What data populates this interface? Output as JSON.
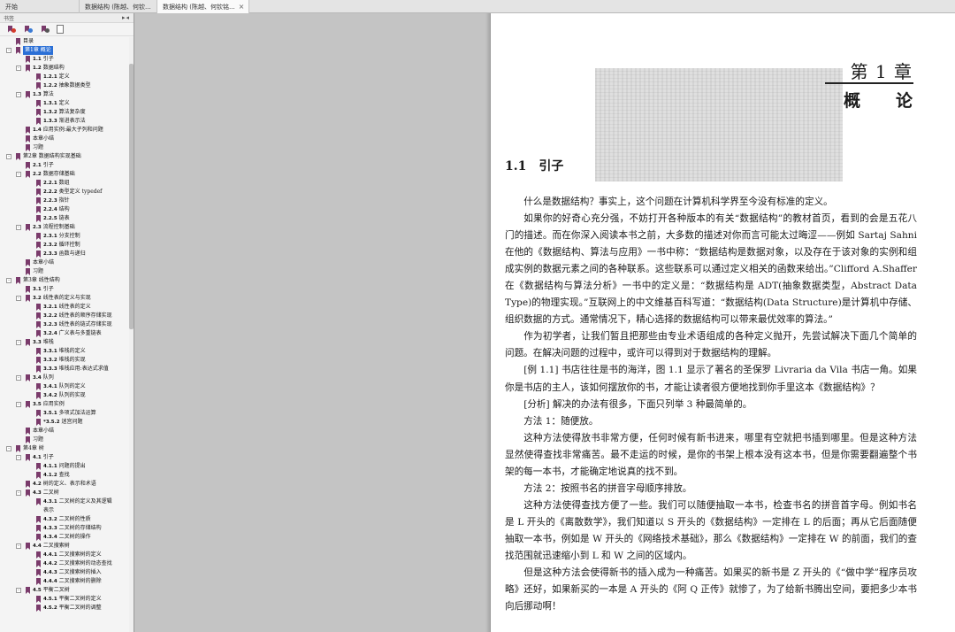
{
  "tabs": [
    {
      "label": "开始"
    },
    {
      "label": "数据结构 (陈越、何钦..."
    },
    {
      "label": "数据结构 (陈越、何钦铭..."
    }
  ],
  "sidebar": {
    "title": "书签",
    "controls": "▸◂",
    "toolbar": [
      "bookmark-expand-icon",
      "bookmark-add-icon",
      "bookmark-delete-icon",
      "bookmark-properties-icon"
    ],
    "items": [
      {
        "num": "",
        "text": "目录",
        "level": 0
      },
      {
        "num": "",
        "text": "第1章  概论",
        "level": 0,
        "toggle": "-",
        "selected": true
      },
      {
        "num": "1.1",
        "text": "引子",
        "level": 1
      },
      {
        "num": "1.2",
        "text": "数据结构",
        "level": 1,
        "toggle": "-"
      },
      {
        "num": "1.2.1",
        "text": "定义",
        "level": 2
      },
      {
        "num": "1.2.2",
        "text": "抽象数据类型",
        "level": 2
      },
      {
        "num": "1.3",
        "text": "算法",
        "level": 1,
        "toggle": "-"
      },
      {
        "num": "1.3.1",
        "text": "定义",
        "level": 2
      },
      {
        "num": "1.3.2",
        "text": "算法复杂度",
        "level": 2
      },
      {
        "num": "1.3.3",
        "text": "渐进表示法",
        "level": 2
      },
      {
        "num": "1.4",
        "text": "应用实例:最大子列和问题",
        "level": 1
      },
      {
        "num": "",
        "text": "本章小结",
        "level": 1
      },
      {
        "num": "",
        "text": "习题",
        "level": 1
      },
      {
        "num": "",
        "text": "第2章  数据结构实现基础",
        "level": 0,
        "toggle": "-"
      },
      {
        "num": "2.1",
        "text": "引子",
        "level": 1
      },
      {
        "num": "2.2",
        "text": "数据存储基础",
        "level": 1,
        "toggle": "-"
      },
      {
        "num": "2.2.1",
        "text": "数组",
        "level": 2
      },
      {
        "num": "2.2.2",
        "text": "类型定义 typedef",
        "level": 2
      },
      {
        "num": "2.2.3",
        "text": "指针",
        "level": 2
      },
      {
        "num": "2.2.4",
        "text": "结构",
        "level": 2
      },
      {
        "num": "2.2.5",
        "text": "链表",
        "level": 2
      },
      {
        "num": "2.3",
        "text": "流程控制基础",
        "level": 1,
        "toggle": "-"
      },
      {
        "num": "2.3.1",
        "text": "分支控制",
        "level": 2
      },
      {
        "num": "2.3.2",
        "text": "循环控制",
        "level": 2
      },
      {
        "num": "2.3.3",
        "text": "函数与递归",
        "level": 2
      },
      {
        "num": "",
        "text": "本章小结",
        "level": 1
      },
      {
        "num": "",
        "text": "习题",
        "level": 1
      },
      {
        "num": "",
        "text": "第3章  线性结构",
        "level": 0,
        "toggle": "-"
      },
      {
        "num": "3.1",
        "text": "引子",
        "level": 1
      },
      {
        "num": "3.2",
        "text": "线性表的定义与实现",
        "level": 1,
        "toggle": "-"
      },
      {
        "num": "3.2.1",
        "text": "线性表的定义",
        "level": 2
      },
      {
        "num": "3.2.2",
        "text": "线性表的顺序存储实现",
        "level": 2
      },
      {
        "num": "3.2.3",
        "text": "线性表的链式存储实现",
        "level": 2
      },
      {
        "num": "3.2.4",
        "text": "广义表与多重链表",
        "level": 2
      },
      {
        "num": "3.3",
        "text": "堆栈",
        "level": 1,
        "toggle": "-"
      },
      {
        "num": "3.3.1",
        "text": "堆栈的定义",
        "level": 2
      },
      {
        "num": "3.3.2",
        "text": "堆栈的实现",
        "level": 2
      },
      {
        "num": "3.3.3",
        "text": "堆栈应用:表达式求值",
        "level": 2
      },
      {
        "num": "3.4",
        "text": "队列",
        "level": 1,
        "toggle": "-"
      },
      {
        "num": "3.4.1",
        "text": "队列的定义",
        "level": 2
      },
      {
        "num": "3.4.2",
        "text": "队列的实现",
        "level": 2
      },
      {
        "num": "3.5",
        "text": "应用实例",
        "level": 1,
        "toggle": "-"
      },
      {
        "num": "3.5.1",
        "text": "多项式加法运算",
        "level": 2
      },
      {
        "num": "*3.5.2",
        "text": "迷宫问题",
        "level": 2
      },
      {
        "num": "",
        "text": "本章小结",
        "level": 1
      },
      {
        "num": "",
        "text": "习题",
        "level": 1
      },
      {
        "num": "",
        "text": "第4章  树",
        "level": 0,
        "toggle": "-"
      },
      {
        "num": "4.1",
        "text": "引子",
        "level": 1,
        "toggle": "-"
      },
      {
        "num": "4.1.1",
        "text": "问题的提出",
        "level": 2
      },
      {
        "num": "4.1.2",
        "text": "查找",
        "level": 2
      },
      {
        "num": "4.2",
        "text": "树的定义、表示和术语",
        "level": 1
      },
      {
        "num": "4.3",
        "text": "二叉树",
        "level": 1,
        "toggle": "-"
      },
      {
        "num": "4.3.1",
        "text": "二叉树的定义及其逻辑",
        "level": 2
      },
      {
        "num": "",
        "text": "表示",
        "level": 2,
        "cont": true
      },
      {
        "num": "4.3.2",
        "text": "二叉树的性质",
        "level": 2
      },
      {
        "num": "4.3.3",
        "text": "二叉树的存储结构",
        "level": 2
      },
      {
        "num": "4.3.4",
        "text": "二叉树的操作",
        "level": 2
      },
      {
        "num": "4.4",
        "text": "二叉搜索树",
        "level": 1,
        "toggle": "-"
      },
      {
        "num": "4.4.1",
        "text": "二叉搜索树的定义",
        "level": 2
      },
      {
        "num": "4.4.2",
        "text": "二叉搜索树的动态查找",
        "level": 2
      },
      {
        "num": "4.4.3",
        "text": "二叉搜索树的插入",
        "level": 2
      },
      {
        "num": "4.4.4",
        "text": "二叉搜索树的删除",
        "level": 2
      },
      {
        "num": "4.5",
        "text": "平衡二叉树",
        "level": 1,
        "toggle": "-"
      },
      {
        "num": "4.5.1",
        "text": "平衡二叉树的定义",
        "level": 2
      },
      {
        "num": "4.5.2",
        "text": "平衡二叉树的调整",
        "level": 2
      }
    ]
  },
  "page": {
    "chapter_number": "第 1 章",
    "chapter_title": "概论",
    "section_number": "1.1",
    "section_title": "引子",
    "paragraphs": [
      "什么是数据结构？事实上，这个问题在计算机科学界至今没有标准的定义。",
      "如果你的好奇心充分强，不妨打开各种版本的有关“数据结构”的教材首页，看到的会是五花八门的描述。而在你深入阅读本书之前，大多数的描述对你而言可能太过晦涩——例如 Sartaj Sahni 在他的《数据结构、算法与应用》一书中称：“数据结构是数据对象，以及存在于该对象的实例和组成实例的数据元素之间的各种联系。这些联系可以通过定义相关的函数来给出。”Clifford A.Shaffer 在《数据结构与算法分析》一书中的定义是：“数据结构是 ADT(抽象数据类型，Abstract Data Type)的物理实现。”互联网上的中文维基百科写道：“数据结构(Data Structure)是计算机中存储、组织数据的方式。通常情况下，精心选择的数据结构可以带来最优效率的算法。”",
      "作为初学者，让我们暂且把那些由专业术语组成的各种定义抛开，先尝试解决下面几个简单的问题。在解决问题的过程中，或许可以得到对于数据结构的理解。",
      "[例 1.1] 书店往往是书的海洋，图 1.1 显示了著名的圣保罗 Livraria da Vila 书店一角。如果你是书店的主人，该如何摆放你的书，才能让读者很方便地找到你手里这本《数据结构》？",
      "[分析] 解决的办法有很多，下面只列举 3 种最简单的。",
      "方法 1：随便放。",
      "这种方法使得放书非常方便，任何时候有新书进来，哪里有空就把书插到哪里。但是这种方法显然使得查找非常痛苦。最不走运的时候，是你的书架上根本没有这本书，但是你需要翻遍整个书架的每一本书，才能确定地说真的找不到。",
      "方法 2：按照书名的拼音字母顺序排放。",
      "这种方法使得查找方便了一些。我们可以随便抽取一本书，检查书名的拼音首字母。例如书名是 L 开头的《离散数学》，我们知道以 S 开头的《数据结构》一定排在 L 的后面；再从它后面随便抽取一本书，例如是 W 开头的《网络技术基础》，那么《数据结构》一定排在 W 的前面，我们的查找范围就迅速缩小到 L 和 W 之间的区域内。",
      "但是这种方法会使得新书的插入成为一种痛苦。如果买的新书是 Z 开头的《“做中学”程序员攻略》还好，如果新买的一本是 A 开头的《阿 Q 正传》就惨了，为了给新书腾出空间，要把多少本书向后挪动啊！"
    ]
  }
}
